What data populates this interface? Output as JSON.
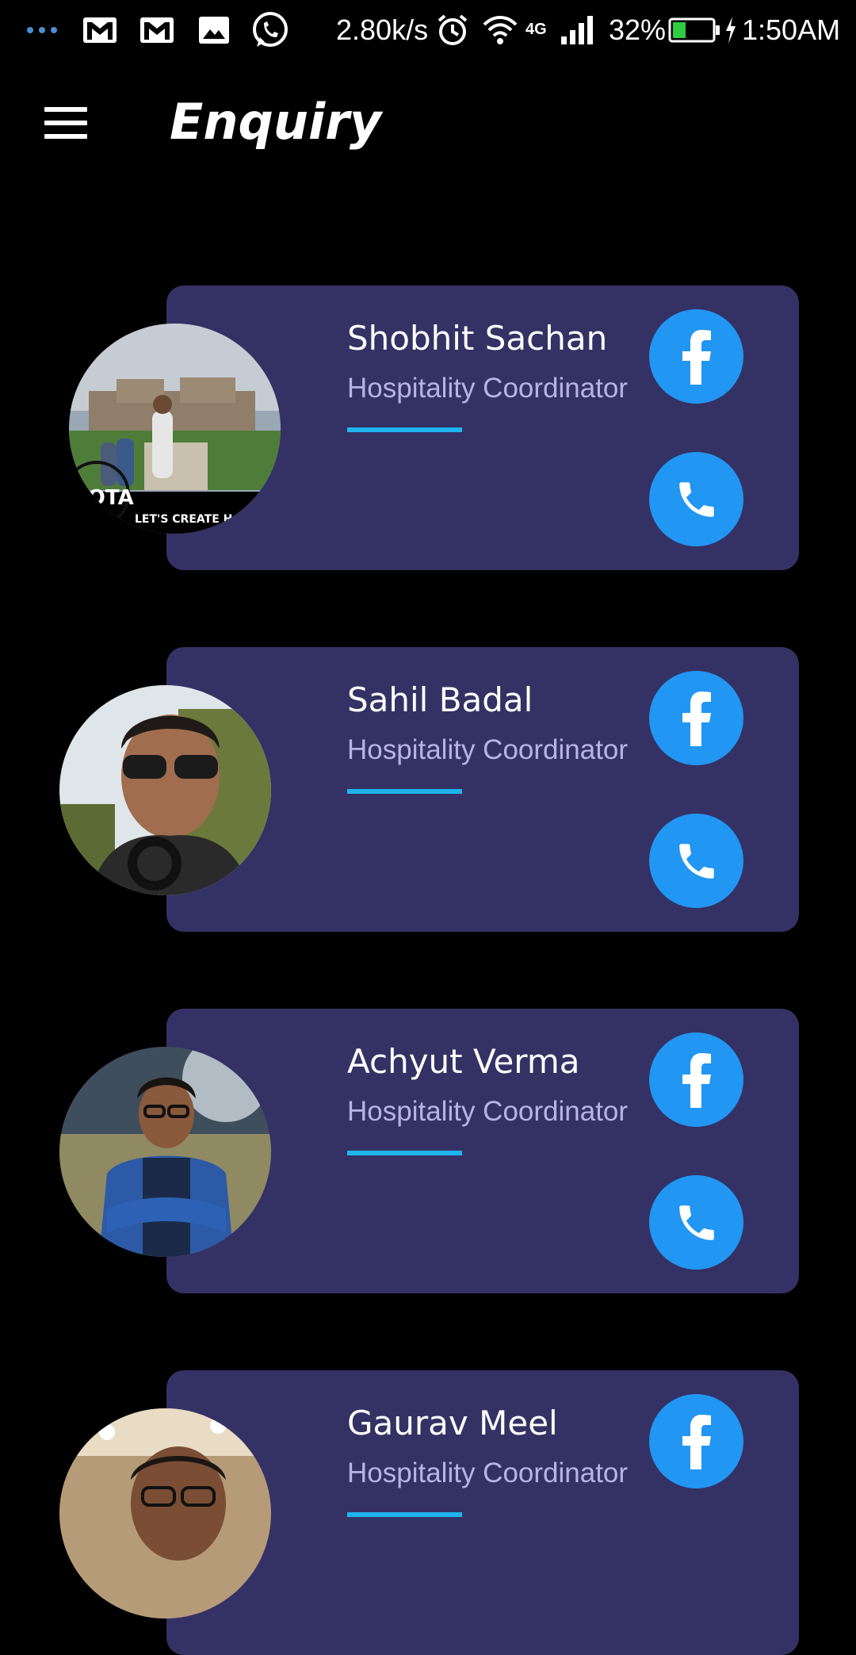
{
  "status_bar": {
    "network_speed": "2.80k/s",
    "network_type": "4G",
    "battery": "32%",
    "time": "1:50AM",
    "icons": [
      "more-dots-icon",
      "gmail-icon",
      "gmail-icon",
      "gallery-icon",
      "whatsapp-icon",
      "alarm-icon",
      "wifi-icon",
      "signal-icon",
      "battery-icon",
      "charging-icon"
    ]
  },
  "app_bar": {
    "title": "Enquiry",
    "menu_icon": "hamburger-menu-icon"
  },
  "colors": {
    "background": "#000000",
    "card": "#343264",
    "role_text": "#b9b2ea",
    "accent_line": "#1eb4ec",
    "button": "#2196f3"
  },
  "contacts": [
    {
      "name": "Shobhit Sachan",
      "role": "Hospitality Coordinator",
      "photo_caption": "LET'S CREATE H",
      "photo_badge": "NOTA"
    },
    {
      "name": "Sahil Badal",
      "role": "Hospitality Coordinator"
    },
    {
      "name": "Achyut Verma",
      "role": "Hospitality Coordinator"
    },
    {
      "name": "Gaurav Meel",
      "role": "Hospitality Coordinator"
    }
  ]
}
